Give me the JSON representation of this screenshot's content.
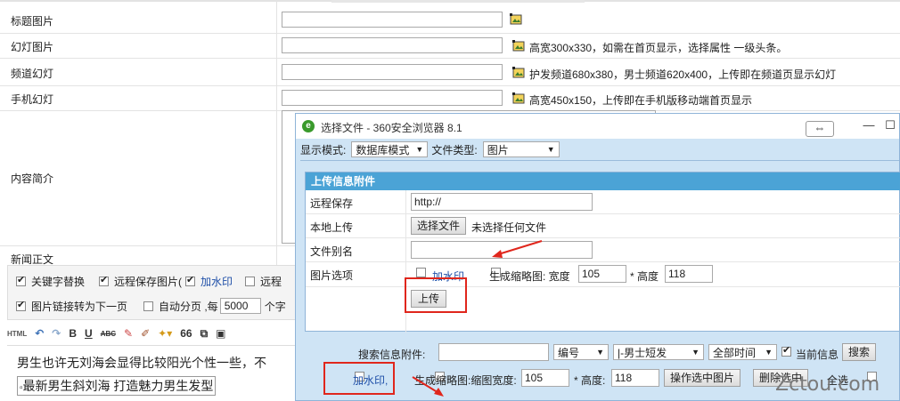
{
  "form": {
    "rows": [
      {
        "label": "标题图片",
        "hint": ""
      },
      {
        "label": "幻灯图片",
        "hint": "高宽300x330，如需在首页显示，选择属性 一级头条。"
      },
      {
        "label": "频道幻灯",
        "hint": "护发频道680x380，男士频道620x400，上传即在频道页显示幻灯"
      },
      {
        "label": "手机幻灯",
        "hint": "高宽450x150，上传即在手机版移动端首页显示"
      }
    ],
    "summary_label": "内容简介",
    "news_label": "新闻正文"
  },
  "editor_options": {
    "keyword_replace": "关键字替换",
    "remote_save": "远程保存图片(",
    "watermark": "加水印",
    "remote_cut": "远程",
    "link_next": "图片链接转为下一页",
    "auto_page": "自动分页 ,每",
    "page_size": "5000",
    "chars": "个字"
  },
  "toolbar": {
    "html": "HTML",
    "bold": "B",
    "underline": "U",
    "abc": "ABC",
    "quote": "66"
  },
  "content": {
    "line1": "男生也许无刘海会显得比较阳光个性一些，不",
    "line2": "最新男生斜刘海 打造魅力男生发型"
  },
  "dialog": {
    "title": "选择文件 - 360安全浏览器 8.1",
    "mode_label": "显示模式:",
    "mode_value": "数据库模式",
    "type_label": "文件类型:",
    "type_value": "图片",
    "panel_title": "上传信息附件",
    "remote_label": "远程保存",
    "remote_value": "http://",
    "local_label": "本地上传",
    "choose_file": "选择文件",
    "no_file": "未选择任何文件",
    "alias_label": "文件别名",
    "img_options_label": "图片选项",
    "watermark": "加水印",
    "thumb": "生成缩略图: 宽度",
    "width_value": "105",
    "height_label": "* 高度",
    "height_value": "118",
    "upload": "上传",
    "search_label": "搜索信息附件:",
    "sort_value": "编号",
    "cat_value": "|-男士短发",
    "time_value": "全部时间",
    "current_info": "当前信息",
    "search_btn": "搜索",
    "watermark2": "加水印,",
    "thumb2": "生成缩略图:缩图宽度:",
    "width2_value": "105",
    "height2_label": "* 高度:",
    "height2_value": "118",
    "op_selected": "操作选中图片",
    "del_selected": "删除选中",
    "select_all": "全选"
  },
  "watermark_site": "Zctou.com",
  "colors": {
    "dialog_bg": "#cfe4f5",
    "panel_header": "#4ba3d6",
    "annotation_red": "#e0261c"
  }
}
